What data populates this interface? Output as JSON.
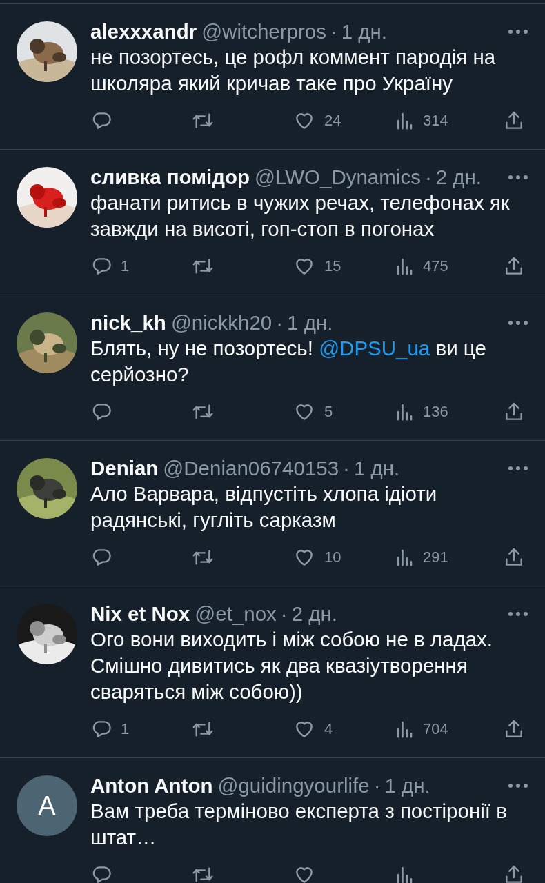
{
  "replies": [
    {
      "name": "alexxxandr",
      "handle": "@witcherpros",
      "dot": "·",
      "time": "1 дн.",
      "text": [
        {
          "kind": "text",
          "text": "не позортесь, це рофл коммент пародія на школяра який кричав таке про Україну"
        }
      ],
      "likes": "24",
      "views": "314"
    },
    {
      "name": "сливка помідор",
      "handle": "@LWO_Dynamics",
      "dot": "·",
      "time": "2 дн.",
      "text": [
        {
          "kind": "text",
          "text": "фанати ритись в чужих речах, телефонах як завжди на висоті, гоп-стоп в погонах"
        }
      ],
      "replies": "1",
      "likes": "15",
      "views": "475"
    },
    {
      "name": "nick_kh",
      "handle": "@nickkh20",
      "dot": "·",
      "time": "1 дн.",
      "text": [
        {
          "kind": "text",
          "text": "Блять, ну не позортесь! "
        },
        {
          "kind": "mention",
          "text": "@DPSU_ua"
        },
        {
          "kind": "text",
          "text": " ви це серйозно?"
        }
      ],
      "likes": "5",
      "views": "136"
    },
    {
      "name": "Denian",
      "handle": "@Denian06740153",
      "dot": "·",
      "time": "1 дн.",
      "text": [
        {
          "kind": "text",
          "text": "Ало Варвара, відпустіть хлопа ідіоти радянські, гугліть сарказм"
        }
      ],
      "likes": "10",
      "views": "291"
    },
    {
      "name": "Nix et Nox",
      "handle": "@et_nox",
      "dot": "·",
      "time": "2 дн.",
      "text": [
        {
          "kind": "text",
          "text": "Ого вони виходить і між собою не в ладах. Смішно дивитись як два квазіутворення сваряться між собою))"
        }
      ],
      "replies": "1",
      "likes": "4",
      "views": "704"
    },
    {
      "avatar": {
        "kind": "letter",
        "letter": "A"
      },
      "name": "Anton Anton",
      "handle": "@guidingyourlife",
      "dot": "·",
      "time": "1 дн.",
      "text": [
        {
          "kind": "text",
          "text": "Вам треба терміново експерта з постіронії в штат…"
        }
      ]
    }
  ]
}
